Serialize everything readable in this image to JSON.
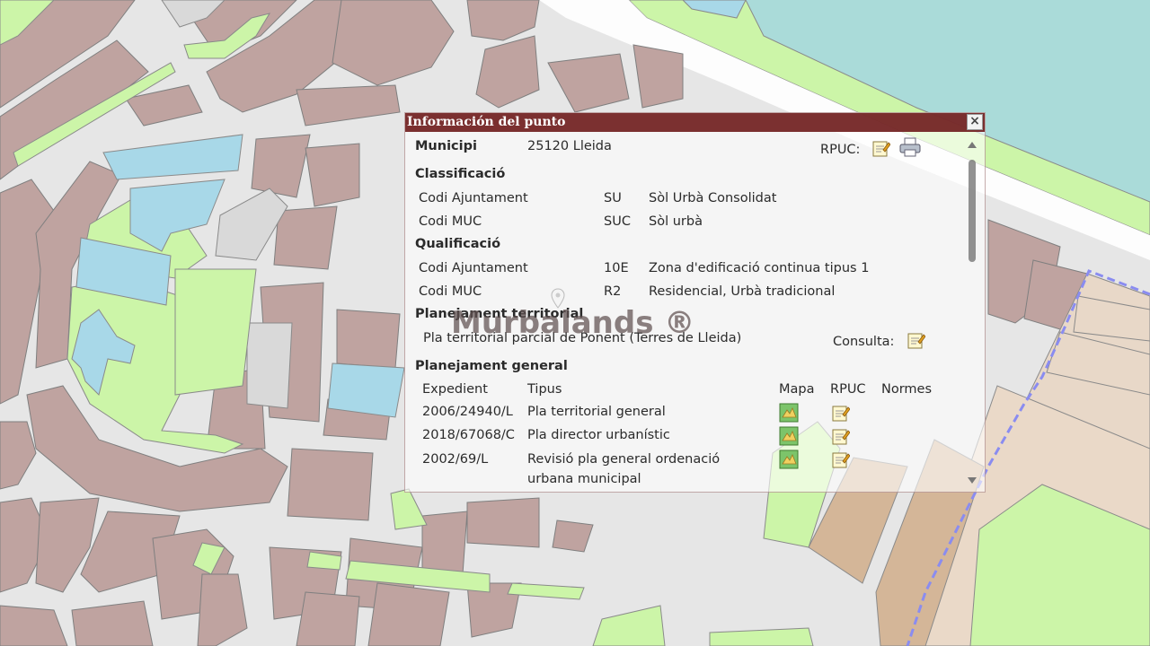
{
  "popup": {
    "title": "Información del punto",
    "close_glyph": "×",
    "municipi_label": "Municipi",
    "municipi_value": "25120 Lleida",
    "rpuc_label": "RPUC:",
    "classificacio": {
      "heading": "Classificació",
      "rows": [
        {
          "label": "Codi Ajuntament",
          "code": "SU",
          "desc": "Sòl Urbà Consolidat"
        },
        {
          "label": "Codi MUC",
          "code": "SUC",
          "desc": "Sòl urbà"
        }
      ]
    },
    "qualificacio": {
      "heading": "Qualificació",
      "rows": [
        {
          "label": "Codi Ajuntament",
          "code": "10E",
          "desc": "Zona d'edificació continua tipus 1"
        },
        {
          "label": "Codi MUC",
          "code": "R2",
          "desc": "Residencial, Urbà tradicional"
        }
      ]
    },
    "territorial": {
      "heading": "Planejament territorial",
      "plan": "Pla territorial parcial de Ponent (Terres de Lleida)",
      "consulta_label": "Consulta:"
    },
    "general": {
      "heading": "Planejament general",
      "headers": {
        "expedient": "Expedient",
        "tipus": "Tipus",
        "mapa": "Mapa",
        "rpuc": "RPUC",
        "normes": "Normes"
      },
      "rows": [
        {
          "expedient": "2006/24940/L",
          "tipus": "Pla territorial general"
        },
        {
          "expedient": "2018/67068/C",
          "tipus": "Pla director urbanístic"
        },
        {
          "expedient": "2002/69/L",
          "tipus": "Revisió pla general ordenació",
          "tipus_line2": "urbana municipal"
        }
      ]
    }
  },
  "watermark": "Murbalands ®",
  "icons": {
    "rpuc": "document-edit-icon",
    "print": "printer-icon",
    "consulta": "document-edit-icon",
    "mapa": "map-icon",
    "marker": "location-pin-icon"
  },
  "colors": {
    "titlebar": "#701e1e",
    "building": "#bfa3a0",
    "green": "#ccf5a8",
    "water": "#a8d8e8",
    "sea": "#aadbd9",
    "boundary": "#8a8cf0",
    "parcel": "#e8d8c8",
    "parcel_dark": "#d4b698"
  }
}
